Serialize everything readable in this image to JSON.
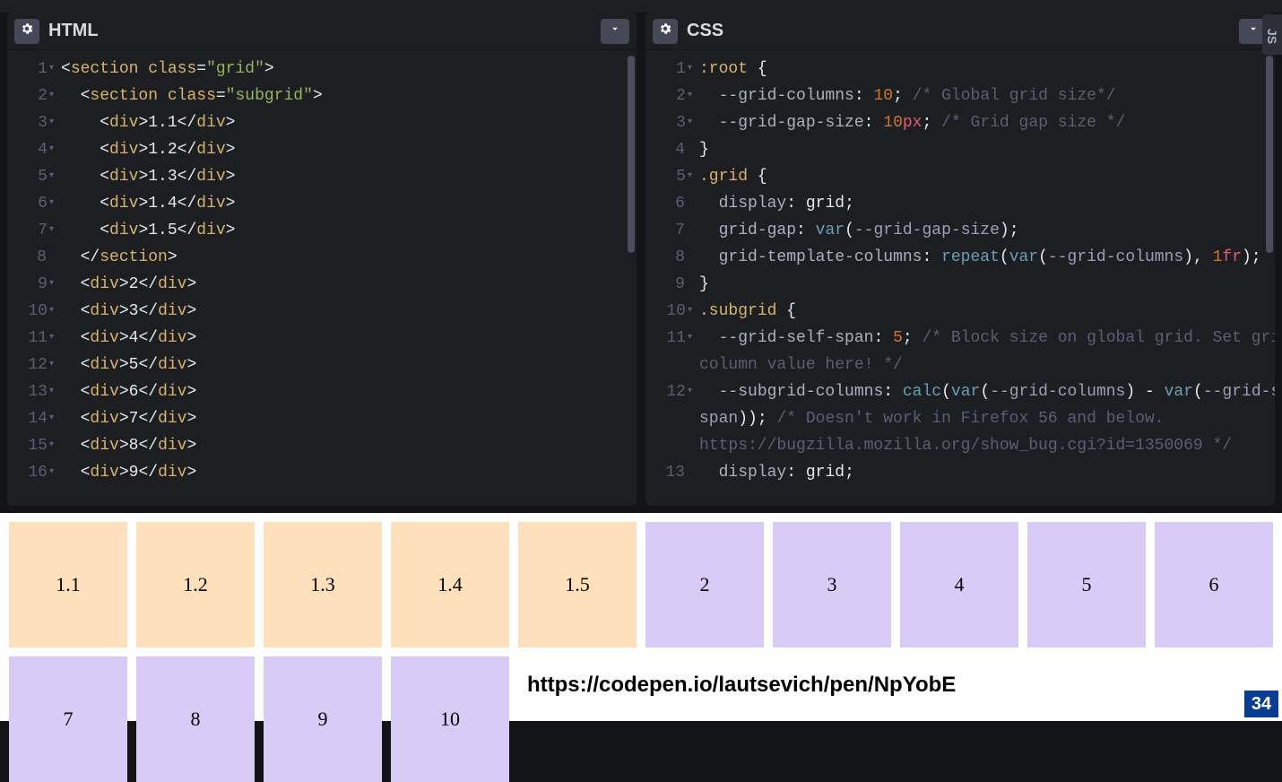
{
  "panels": {
    "html": {
      "title": "HTML"
    },
    "css": {
      "title": "CSS"
    },
    "js": {
      "title": "JS"
    }
  },
  "html_code": {
    "lines": [
      {
        "n": 1,
        "arrow": true,
        "indent": 0,
        "kind": "open",
        "tag": "section",
        "attrs": [
          [
            "class",
            "grid"
          ]
        ]
      },
      {
        "n": 2,
        "arrow": true,
        "indent": 1,
        "kind": "open",
        "tag": "section",
        "attrs": [
          [
            "class",
            "subgrid"
          ]
        ]
      },
      {
        "n": 3,
        "arrow": true,
        "indent": 2,
        "kind": "leaf",
        "tag": "div",
        "text": "1.1"
      },
      {
        "n": 4,
        "arrow": true,
        "indent": 2,
        "kind": "leaf",
        "tag": "div",
        "text": "1.2"
      },
      {
        "n": 5,
        "arrow": true,
        "indent": 2,
        "kind": "leaf",
        "tag": "div",
        "text": "1.3"
      },
      {
        "n": 6,
        "arrow": true,
        "indent": 2,
        "kind": "leaf",
        "tag": "div",
        "text": "1.4"
      },
      {
        "n": 7,
        "arrow": true,
        "indent": 2,
        "kind": "leaf",
        "tag": "div",
        "text": "1.5"
      },
      {
        "n": 8,
        "arrow": false,
        "indent": 1,
        "kind": "close",
        "tag": "section"
      },
      {
        "n": 9,
        "arrow": true,
        "indent": 1,
        "kind": "leaf",
        "tag": "div",
        "text": "2"
      },
      {
        "n": 10,
        "arrow": true,
        "indent": 1,
        "kind": "leaf",
        "tag": "div",
        "text": "3"
      },
      {
        "n": 11,
        "arrow": true,
        "indent": 1,
        "kind": "leaf",
        "tag": "div",
        "text": "4"
      },
      {
        "n": 12,
        "arrow": true,
        "indent": 1,
        "kind": "leaf",
        "tag": "div",
        "text": "5"
      },
      {
        "n": 13,
        "arrow": true,
        "indent": 1,
        "kind": "leaf",
        "tag": "div",
        "text": "6"
      },
      {
        "n": 14,
        "arrow": true,
        "indent": 1,
        "kind": "leaf",
        "tag": "div",
        "text": "7"
      },
      {
        "n": 15,
        "arrow": true,
        "indent": 1,
        "kind": "leaf",
        "tag": "div",
        "text": "8"
      },
      {
        "n": 16,
        "arrow": true,
        "indent": 1,
        "kind": "leaf",
        "tag": "div",
        "text": "9"
      }
    ]
  },
  "css_code": {
    "lines": [
      {
        "n": 1,
        "arrow": true,
        "html": "<span class='kw'>:root</span> <span class='punct'>{</span>"
      },
      {
        "n": 2,
        "arrow": true,
        "html": "  <span class='prop'>--grid-columns</span><span class='punct'>:</span> <span class='num'>10</span><span class='punct'>;</span> <span class='comment'>/* Global grid size*/</span>"
      },
      {
        "n": 3,
        "arrow": true,
        "html": "  <span class='prop'>--grid-gap-size</span><span class='punct'>:</span> <span class='num'>10</span><span class='unit'>px</span><span class='punct'>;</span> <span class='comment'>/* Grid gap size */</span>"
      },
      {
        "n": 4,
        "arrow": false,
        "html": "<span class='punct'>}</span>"
      },
      {
        "n": 5,
        "arrow": true,
        "html": "<span class='kw'>.grid</span> <span class='punct'>{</span>"
      },
      {
        "n": 6,
        "arrow": false,
        "html": "  <span class='prop'>display</span><span class='punct'>:</span> <span class='plain'>grid</span><span class='punct'>;</span>"
      },
      {
        "n": 7,
        "arrow": false,
        "html": "  <span class='prop'>grid-gap</span><span class='punct'>:</span> <span class='func'>var</span><span class='punct'>(</span><span class='var'>--grid-gap-size</span><span class='punct'>);</span>"
      },
      {
        "n": 8,
        "arrow": false,
        "html": "  <span class='prop'>grid-template-columns</span><span class='punct'>:</span> <span class='func'>repeat</span><span class='punct'>(</span><span class='func'>var</span><span class='punct'>(</span><span class='var'>--grid-columns</span><span class='punct'>),</span> <span class='num'>1</span><span class='unit'>fr</span><span class='punct'>);</span>"
      },
      {
        "n": 9,
        "arrow": false,
        "html": "<span class='punct'>}</span>"
      },
      {
        "n": 10,
        "arrow": true,
        "html": "<span class='kw'>.subgrid</span> <span class='punct'>{</span>"
      },
      {
        "n": 11,
        "arrow": true,
        "html": "  <span class='prop'>--grid-self-span</span><span class='punct'>:</span> <span class='num'>5</span><span class='punct'>;</span> <span class='comment'>/* Block size on global grid. Set grid-</span>"
      },
      {
        "n": 0,
        "arrow": false,
        "html": "<span class='comment'>column value here! */</span>"
      },
      {
        "n": 12,
        "arrow": true,
        "html": "  <span class='prop'>--subgrid-columns</span><span class='punct'>:</span> <span class='func'>calc</span><span class='punct'>(</span><span class='func'>var</span><span class='punct'>(</span><span class='var'>--grid-columns</span><span class='punct'>)</span> <span class='punct'>-</span> <span class='func'>var</span><span class='punct'>(</span><span class='var'>--grid-self-</span>"
      },
      {
        "n": 0,
        "arrow": false,
        "html": "<span class='var'>span</span><span class='punct'>));</span> <span class='comment'>/* Doesn't work in Firefox 56 and below.</span>"
      },
      {
        "n": 0,
        "arrow": false,
        "html": "<span class='comment'>https://bugzilla.mozilla.org/show_bug.cgi?id=1350069 */</span>"
      },
      {
        "n": 13,
        "arrow": false,
        "html": "  <span class='prop'>display</span><span class='punct'>:</span> <span class='plain'>grid</span><span class='punct'>;</span>"
      }
    ]
  },
  "preview": {
    "row1": [
      {
        "text": "1.1",
        "type": "sub"
      },
      {
        "text": "1.2",
        "type": "sub"
      },
      {
        "text": "1.3",
        "type": "sub"
      },
      {
        "text": "1.4",
        "type": "sub"
      },
      {
        "text": "1.5",
        "type": "sub"
      },
      {
        "text": "2",
        "type": "norm"
      },
      {
        "text": "3",
        "type": "norm"
      },
      {
        "text": "4",
        "type": "norm"
      },
      {
        "text": "5",
        "type": "norm"
      },
      {
        "text": "6",
        "type": "norm"
      }
    ],
    "row2": [
      {
        "text": "7",
        "type": "norm"
      },
      {
        "text": "8",
        "type": "norm"
      },
      {
        "text": "9",
        "type": "norm"
      },
      {
        "text": "10",
        "type": "norm"
      }
    ]
  },
  "overlay_url": "https://codepen.io/lautsevich/pen/NpYobE",
  "slide_number": "34"
}
